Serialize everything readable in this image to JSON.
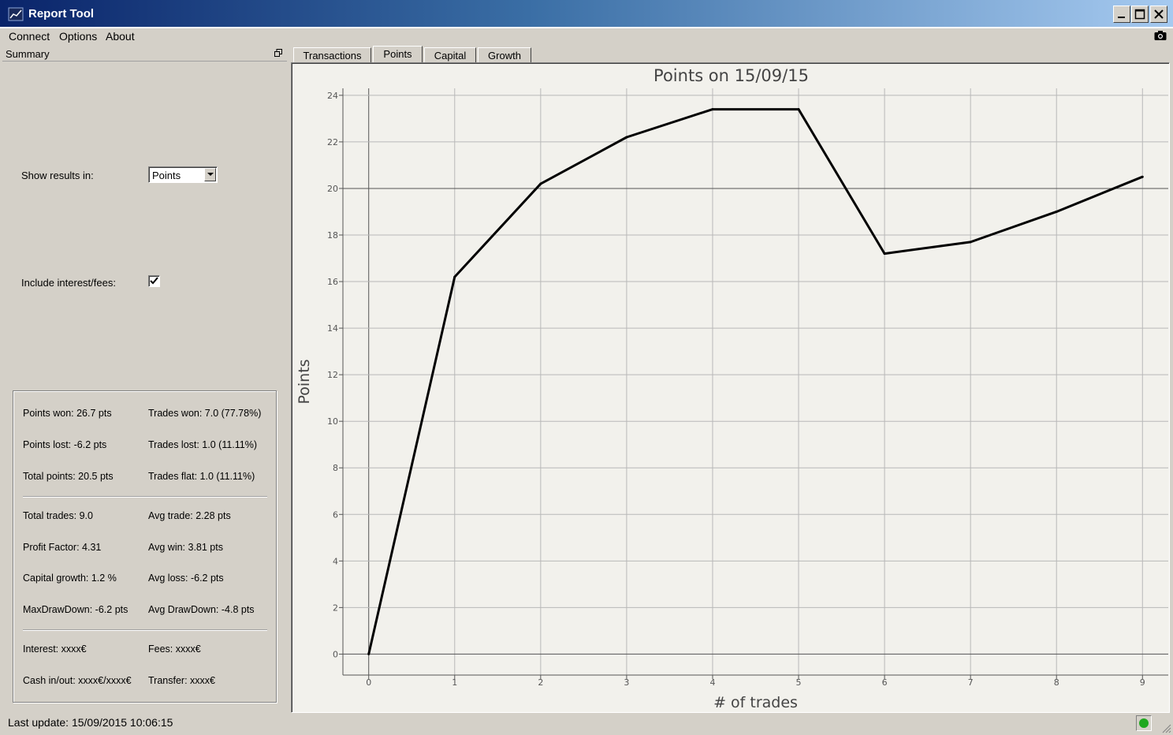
{
  "window": {
    "title": "Report Tool"
  },
  "menu": [
    "Connect",
    "Options",
    "About"
  ],
  "summary_panel": {
    "title": "Summary",
    "show_results_label": "Show results in:",
    "show_results_value": "Points",
    "include_label": "Include interest/fees:",
    "include_checked": true,
    "stats": {
      "points_won": "Points won: 26.7 pts",
      "trades_won": "Trades won: 7.0 (77.78%)",
      "points_lost": "Points lost: -6.2 pts",
      "trades_lost": "Trades lost: 1.0 (11.11%)",
      "total_points": "Total points: 20.5 pts",
      "trades_flat": "Trades flat: 1.0 (11.11%)",
      "total_trades": "Total trades: 9.0",
      "avg_trade": "Avg trade: 2.28 pts",
      "profit_factor": "Profit Factor: 4.31",
      "avg_win": "Avg win: 3.81 pts",
      "capital_growth": "Capital growth: 1.2 %",
      "avg_loss": "Avg loss: -6.2 pts",
      "max_drawdown": "MaxDrawDown: -6.2 pts",
      "avg_drawdown": "Avg DrawDown: -4.8 pts",
      "interest": "Interest: xxxx€",
      "fees": "Fees: xxxx€",
      "cash_inout": "Cash in/out: xxxx€/xxxx€",
      "transfer": "Transfer: xxxx€"
    }
  },
  "tabs": [
    "Transactions",
    "Points",
    "Capital",
    "Growth"
  ],
  "active_tab": "Points",
  "chart_data": {
    "type": "line",
    "title": "Points on 15/09/15",
    "xlabel": "# of trades",
    "ylabel": "Points",
    "x": [
      0,
      1,
      2,
      3,
      4,
      5,
      6,
      7,
      8,
      9
    ],
    "y": [
      0,
      16.2,
      20.2,
      22.2,
      23.4,
      23.4,
      17.2,
      17.7,
      19.0,
      20.5
    ],
    "xlim": [
      -0.3,
      9.3
    ],
    "ylim": [
      -0.9,
      24.3
    ],
    "xticks": [
      0,
      1,
      2,
      3,
      4,
      5,
      6,
      7,
      8,
      9
    ],
    "yticks": [
      0,
      2,
      4,
      6,
      8,
      10,
      12,
      14,
      16,
      18,
      20,
      22,
      24
    ],
    "grid": true,
    "line_color": "#000000"
  },
  "status": {
    "last_update": "Last update: 15/09/2015 10:06:15",
    "connection_color": "#1fa81f"
  }
}
